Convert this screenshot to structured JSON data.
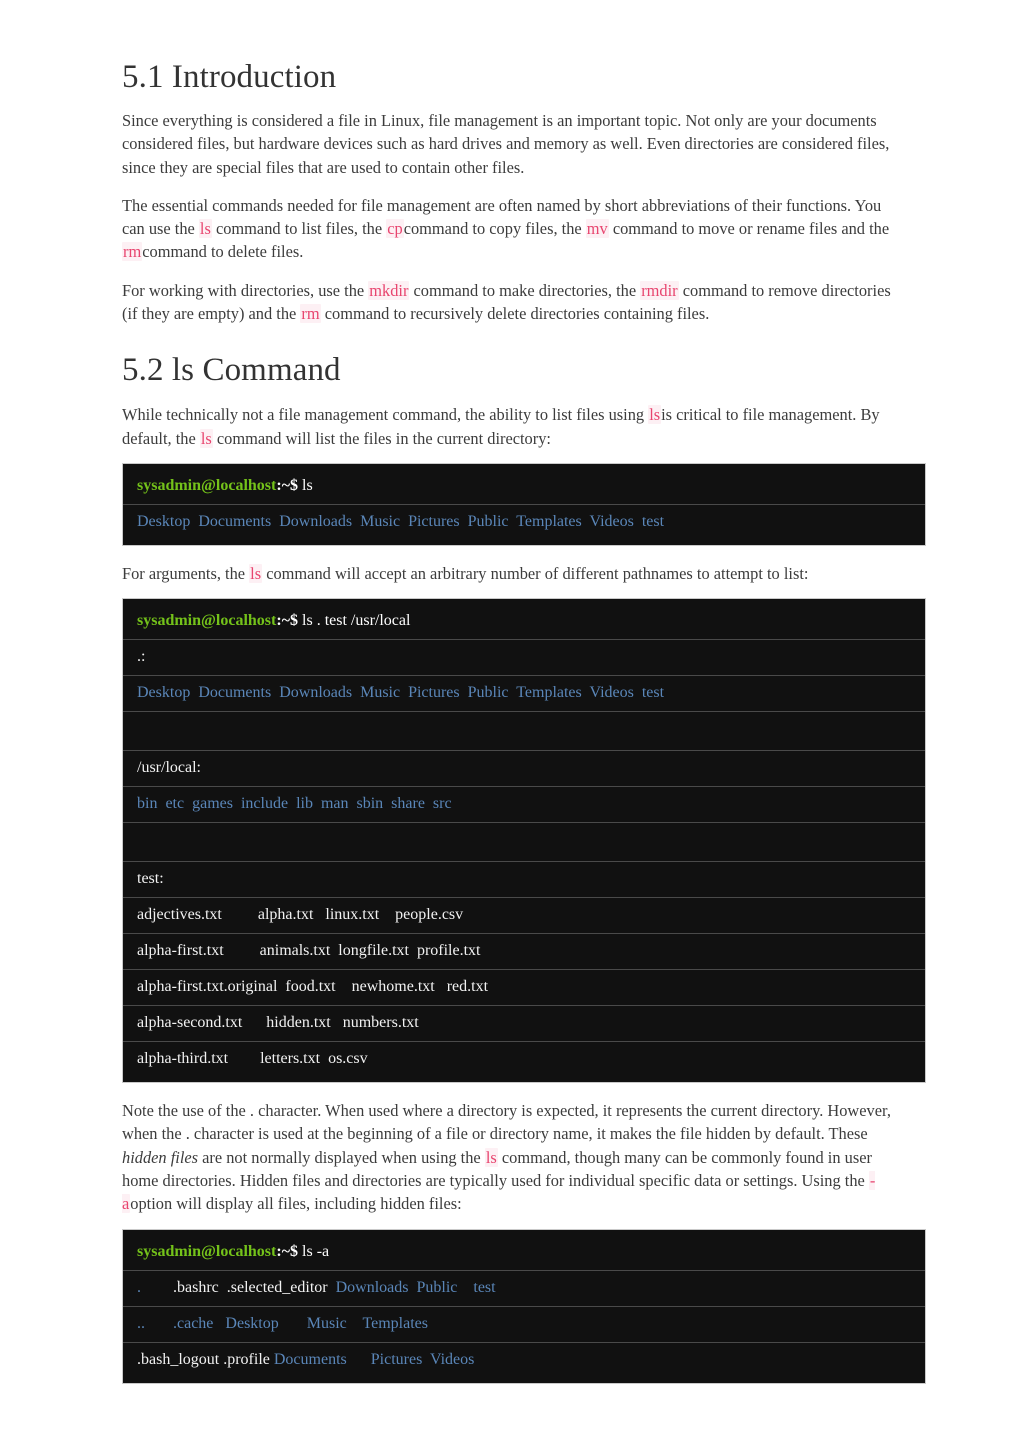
{
  "document": {
    "sections": [
      {
        "id": "intro",
        "heading": "5.1 Introduction",
        "paragraphs": [
          {
            "id": "p1",
            "runs": [
              {
                "type": "text",
                "text": "Since everything is considered a file in Linux, file management is an important topic. Not only are your documents considered files, but hardware devices such as hard drives and memory as well. Even directories are considered files, since they are special files that are used to contain other files."
              }
            ]
          },
          {
            "id": "p2",
            "runs": [
              {
                "type": "text",
                "text": "The essential commands needed for file management are often named by short abbreviations of their functions. You can use the "
              },
              {
                "type": "code",
                "text": "ls"
              },
              {
                "type": "text",
                "text": " command to list files, the "
              },
              {
                "type": "code",
                "text": "cp"
              },
              {
                "type": "text",
                "text": "command to copy files, the "
              },
              {
                "type": "code",
                "text": "mv"
              },
              {
                "type": "text",
                "text": " command to move or rename files and the "
              },
              {
                "type": "code",
                "text": "rm"
              },
              {
                "type": "text",
                "text": "command to delete files."
              }
            ]
          },
          {
            "id": "p3",
            "runs": [
              {
                "type": "text",
                "text": "For working with directories, use the "
              },
              {
                "type": "code",
                "text": "mkdir"
              },
              {
                "type": "text",
                "text": " command to make directories, the "
              },
              {
                "type": "code",
                "text": "rmdir"
              },
              {
                "type": "text",
                "text": " command to remove directories (if they are empty) and the "
              },
              {
                "type": "code",
                "text": "rm"
              },
              {
                "type": "text",
                "text": " command to recursively delete directories containing files."
              }
            ]
          }
        ]
      },
      {
        "id": "ls-command",
        "heading": "5.2 ls Command",
        "paragraphs": [
          {
            "id": "p4",
            "runs": [
              {
                "type": "text",
                "text": "While technically not a file management command, the ability to list files using "
              },
              {
                "type": "code",
                "text": "ls"
              },
              {
                "type": "text",
                "text": "is critical to file management. By default, the "
              },
              {
                "type": "code",
                "text": "ls"
              },
              {
                "type": "text",
                "text": " command will list the files in the current directory:"
              }
            ]
          },
          {
            "id": "p5",
            "runs": [
              {
                "type": "text",
                "text": "For arguments, the "
              },
              {
                "type": "code",
                "text": "ls"
              },
              {
                "type": "text",
                "text": " command will accept an arbitrary number of different pathnames to attempt to list:"
              }
            ]
          },
          {
            "id": "p6",
            "runs": [
              {
                "type": "text",
                "text": "Note the use of the . character. When used where a directory is expected, it represents the current directory. However, when the . character is used at the beginning of a file or directory name, it makes the file hidden by default. These "
              },
              {
                "type": "italic",
                "text": "hidden files"
              },
              {
                "type": "text",
                "text": " are not normally displayed when using the "
              },
              {
                "type": "code",
                "text": "ls"
              },
              {
                "type": "text",
                "text": " command, though many can be commonly found in user home directories. Hidden files and directories are typically used for individual specific data or settings. Using the "
              },
              {
                "type": "code",
                "text": "-a"
              },
              {
                "type": "text",
                "text": "option will display all files, including hidden files:"
              }
            ]
          }
        ]
      }
    ],
    "terminals": [
      {
        "id": "terminal-1",
        "rows": [
          {
            "kind": "prompt",
            "user": "sysadmin@localhost",
            "sep": ":~$",
            "command": " ls"
          },
          {
            "kind": "output",
            "spans": [
              {
                "style": "dir",
                "text": "Desktop  Documents  Downloads  Music  Pictures  Public  Templates  Videos  test"
              }
            ]
          }
        ]
      },
      {
        "id": "terminal-2",
        "rows": [
          {
            "kind": "prompt",
            "user": "sysadmin@localhost",
            "sep": ":~$",
            "command": " ls . test /usr/local"
          },
          {
            "kind": "output",
            "spans": [
              {
                "style": "plain",
                "text": ".:"
              }
            ]
          },
          {
            "kind": "output",
            "spans": [
              {
                "style": "dir",
                "text": "Desktop  Documents  Downloads  Music  Pictures  Public  Templates  Videos  test"
              }
            ]
          },
          {
            "kind": "blank",
            "spans": [
              {
                "style": "plain",
                "text": " "
              }
            ]
          },
          {
            "kind": "output",
            "spans": [
              {
                "style": "plain",
                "text": "/usr/local:"
              }
            ]
          },
          {
            "kind": "output",
            "spans": [
              {
                "style": "dir",
                "text": "bin  etc  games  include  lib  man  sbin  share  src"
              }
            ]
          },
          {
            "kind": "blank",
            "spans": [
              {
                "style": "plain",
                "text": " "
              }
            ]
          },
          {
            "kind": "output",
            "spans": [
              {
                "style": "plain",
                "text": "test:"
              }
            ]
          },
          {
            "kind": "output",
            "spans": [
              {
                "style": "file",
                "text": "adjectives.txt         alpha.txt   linux.txt    people.csv"
              }
            ]
          },
          {
            "kind": "output",
            "spans": [
              {
                "style": "file",
                "text": "alpha-first.txt         animals.txt  longfile.txt  profile.txt"
              }
            ]
          },
          {
            "kind": "output",
            "spans": [
              {
                "style": "file",
                "text": "alpha-first.txt.original  food.txt    newhome.txt   red.txt"
              }
            ]
          },
          {
            "kind": "output",
            "spans": [
              {
                "style": "file",
                "text": "alpha-second.txt      hidden.txt   numbers.txt"
              }
            ]
          },
          {
            "kind": "output",
            "spans": [
              {
                "style": "file",
                "text": "alpha-third.txt        letters.txt  os.csv"
              }
            ]
          }
        ]
      },
      {
        "id": "terminal-3",
        "rows": [
          {
            "kind": "prompt",
            "user": "sysadmin@localhost",
            "sep": ":~$",
            "command": " ls -a"
          },
          {
            "kind": "output",
            "spans": [
              {
                "style": "dir",
                "text": "."
              },
              {
                "style": "file",
                "text": "        .bashrc  .selected_editor  "
              },
              {
                "style": "dir",
                "text": "Downloads  Public    test"
              }
            ]
          },
          {
            "kind": "output",
            "spans": [
              {
                "style": "dir",
                "text": ".."
              },
              {
                "style": "file",
                "text": "       "
              },
              {
                "style": "dir",
                "text": ".cache   Desktop       Music    Templates"
              }
            ]
          },
          {
            "kind": "output",
            "spans": [
              {
                "style": "file",
                "text": ".bash_logout .profile "
              },
              {
                "style": "dir",
                "text": "Documents      Pictures  Videos"
              }
            ]
          }
        ]
      }
    ]
  },
  "colors": {
    "prompt_green": "#74c21a",
    "directory_blue": "#5a86b8",
    "inline_code_pink": "#e8456f",
    "inline_code_bg": "#fdf0f4",
    "terminal_bg": "#111111",
    "terminal_border": "#c9c9c9",
    "row_separator": "#4a4a4a",
    "heading_color": "#333333",
    "body_color": "#3c3c3c"
  }
}
